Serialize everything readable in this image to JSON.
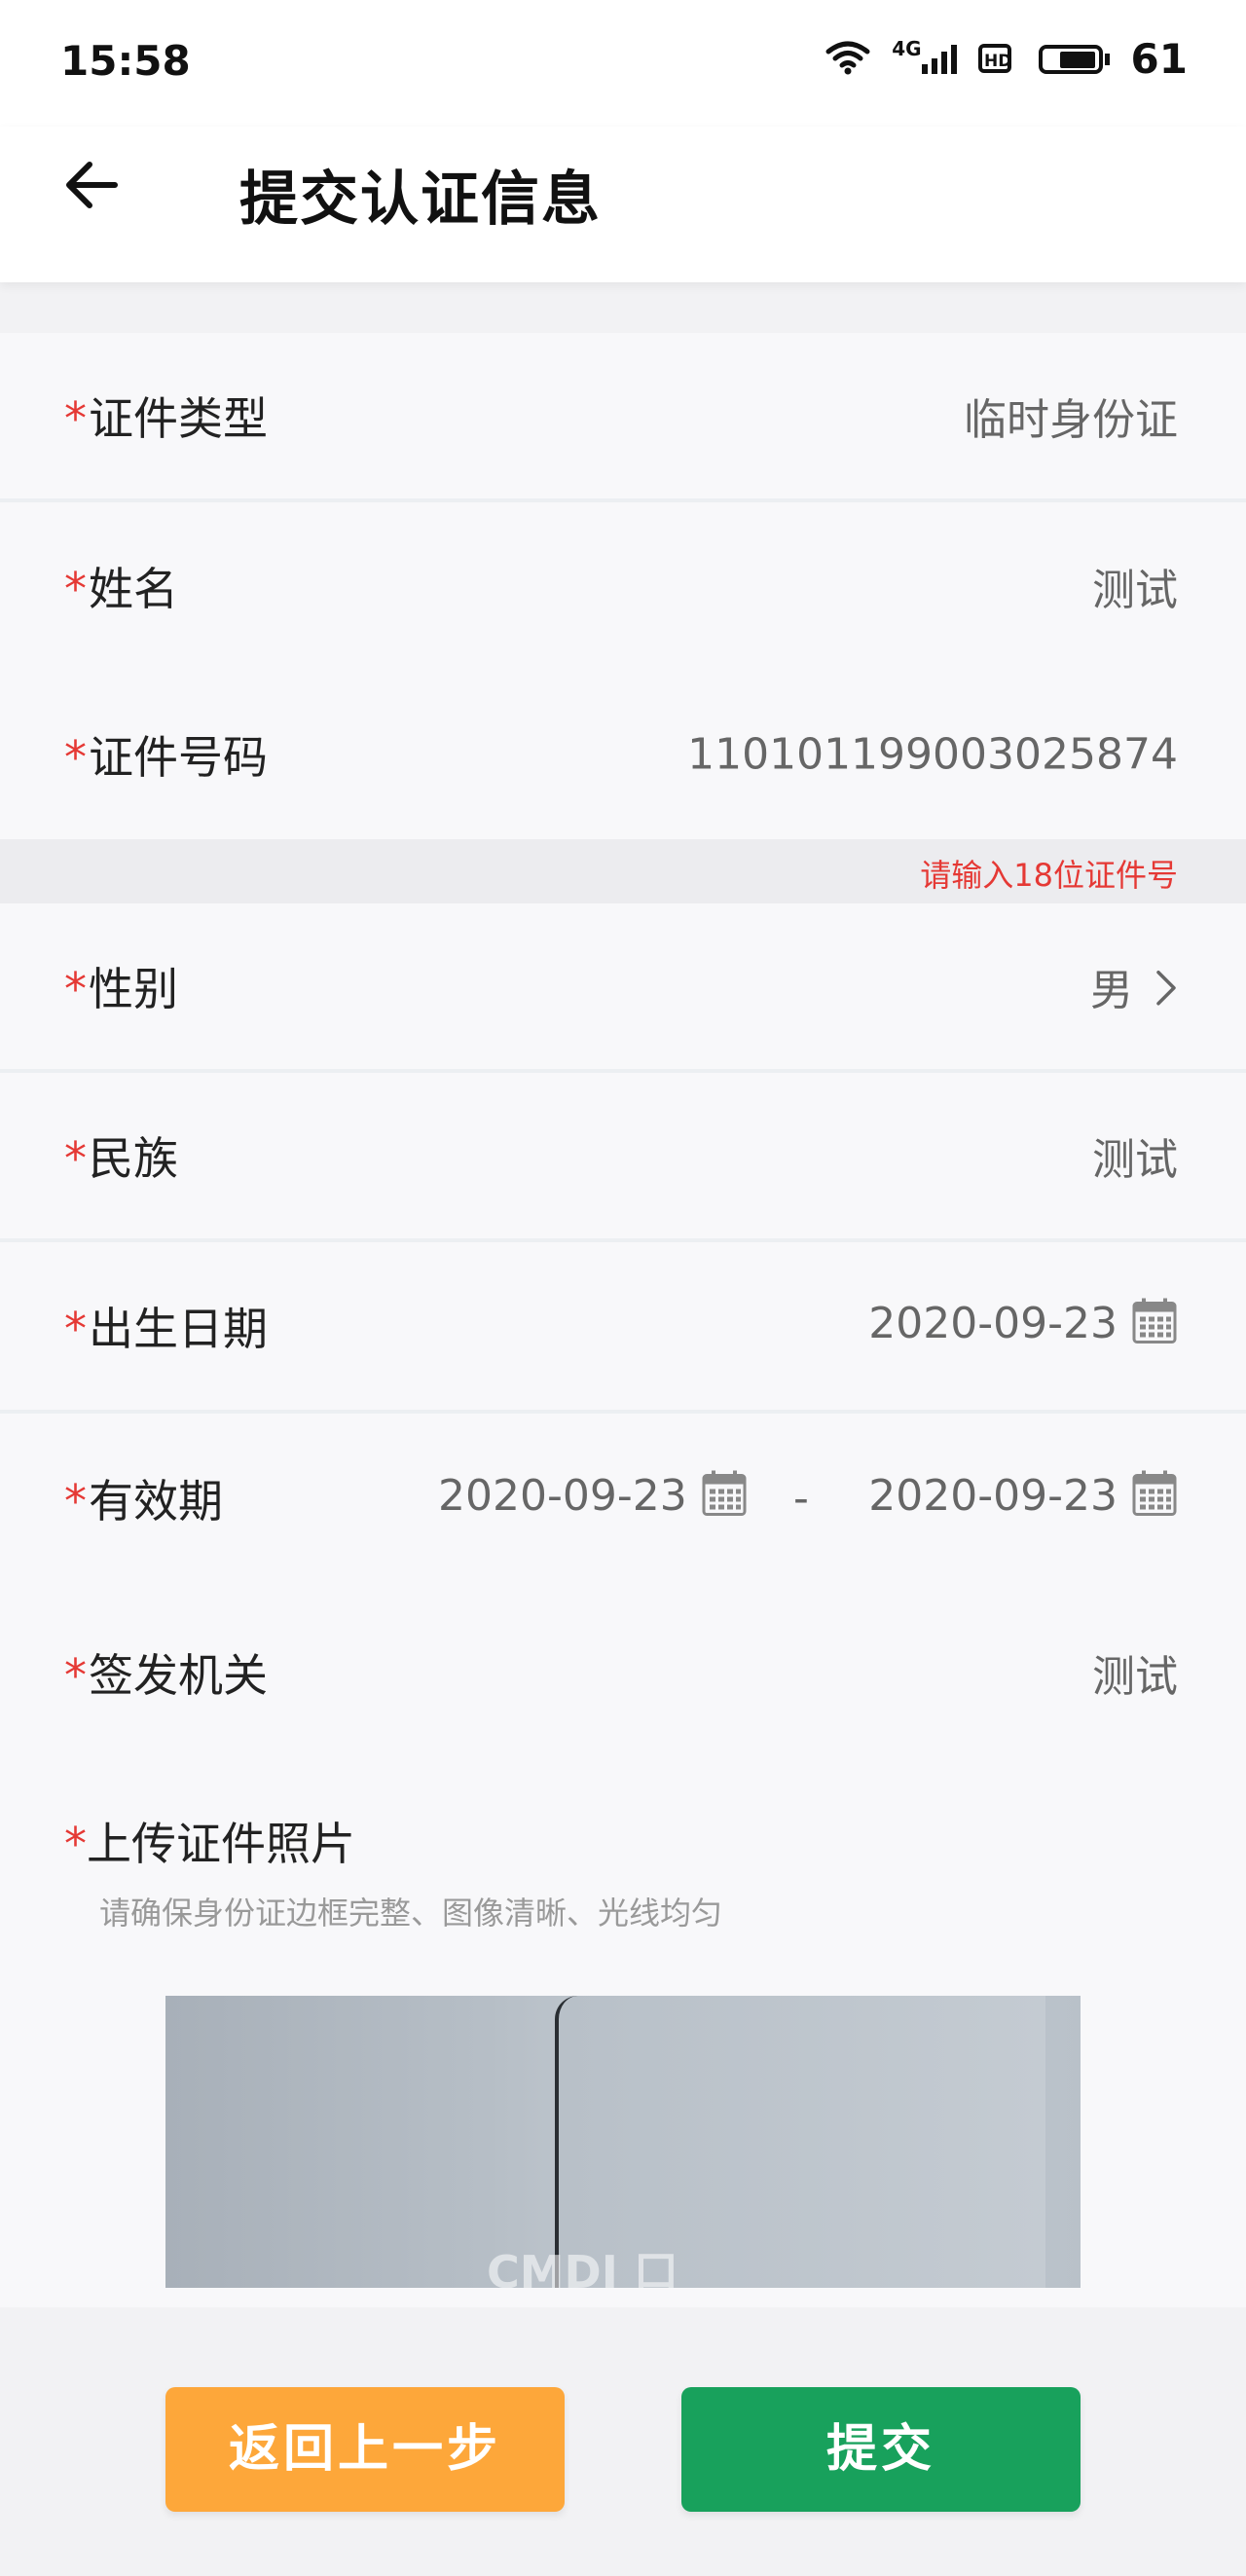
{
  "status_bar": {
    "time": "15:58",
    "network": "4G",
    "battery": "61"
  },
  "header": {
    "title": "提交认证信息"
  },
  "form": {
    "id_type": {
      "label": "证件类型",
      "value": "临时身份证"
    },
    "name": {
      "label": "姓名",
      "value": "测试"
    },
    "id_number": {
      "label": "证件号码",
      "value": "110101199003025874"
    },
    "id_hint": "请输入18位证件号",
    "gender": {
      "label": "性别",
      "value": "男"
    },
    "ethnicity": {
      "label": "民族",
      "value": "测试"
    },
    "birth_date": {
      "label": "出生日期",
      "value": "2020-09-23"
    },
    "validity": {
      "label": "有效期",
      "start": "2020-09-23",
      "separator": "-",
      "end": "2020-09-23"
    },
    "issuer": {
      "label": "签发机关",
      "value": "测试"
    },
    "upload": {
      "label": "上传证件照片",
      "tip": "请确保身份证边框完整、图像清晰、光线均匀",
      "watermark": "CMDI 口"
    },
    "required_mark": "*"
  },
  "actions": {
    "back_label": "返回上一步",
    "submit_label": "提交"
  },
  "colors": {
    "required": "#e53935",
    "back_button": "#fda73a",
    "submit_button": "#18a15c"
  }
}
